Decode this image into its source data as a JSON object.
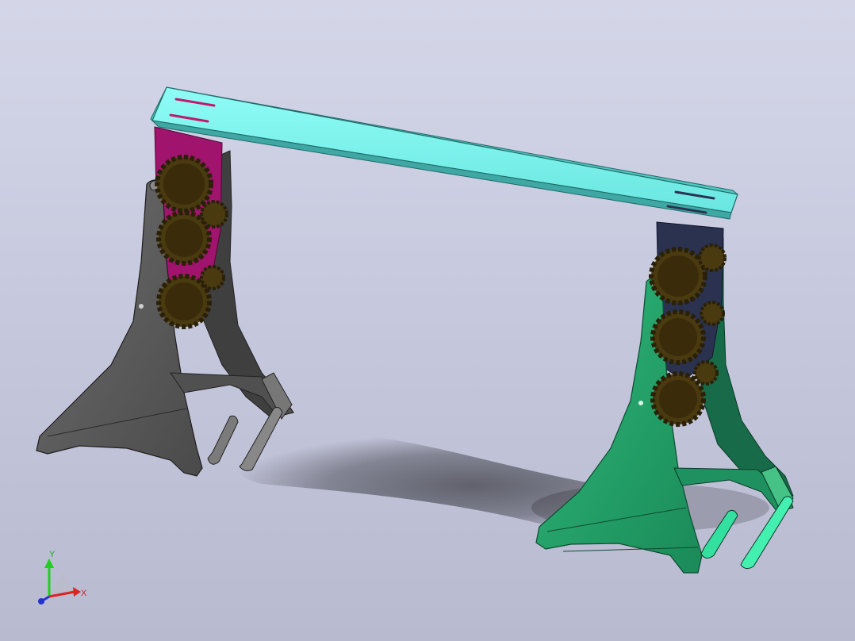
{
  "viewport": {
    "background_top": "#d4d6e8",
    "background_bottom": "#b8bad0"
  },
  "model": {
    "parts": [
      {
        "name": "crossbar",
        "color": "#7ff5f0"
      },
      {
        "name": "left-stand",
        "color": "#5a5a5a"
      },
      {
        "name": "right-stand",
        "color": "#22a06a"
      },
      {
        "name": "left-slider",
        "color": "#a0146e"
      },
      {
        "name": "right-slider",
        "color": "#2a3250"
      },
      {
        "name": "gears",
        "color": "#4a3a10"
      }
    ]
  },
  "triad": {
    "y_label": "Y",
    "x_label": "X",
    "z_label": "",
    "y_color": "#22cc22",
    "x_color": "#dd2222",
    "z_color": "#2233cc"
  }
}
